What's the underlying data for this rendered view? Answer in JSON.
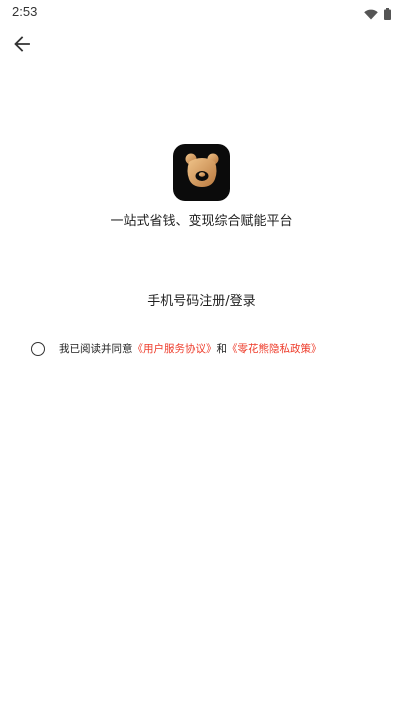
{
  "status_bar": {
    "time": "2:53",
    "icons": [
      "wifi-icon",
      "battery-icon"
    ]
  },
  "nav": {
    "back_icon": "arrow-left-icon"
  },
  "brand": {
    "logo_icon": "bear-logo-icon",
    "tagline": "一站式省钱、变现综合赋能平台"
  },
  "login": {
    "phone_register_label": "手机号码注册/登录"
  },
  "agreement": {
    "prefix": "我已阅读并同意",
    "user_agreement": "《用户服务协议》",
    "and": "和",
    "privacy_policy": "《零花熊隐私政策》",
    "checked": false
  },
  "colors": {
    "link": "#ee3b2a",
    "logo_bg": "#0b0b0b",
    "logo_gold": "#d9a46a"
  }
}
